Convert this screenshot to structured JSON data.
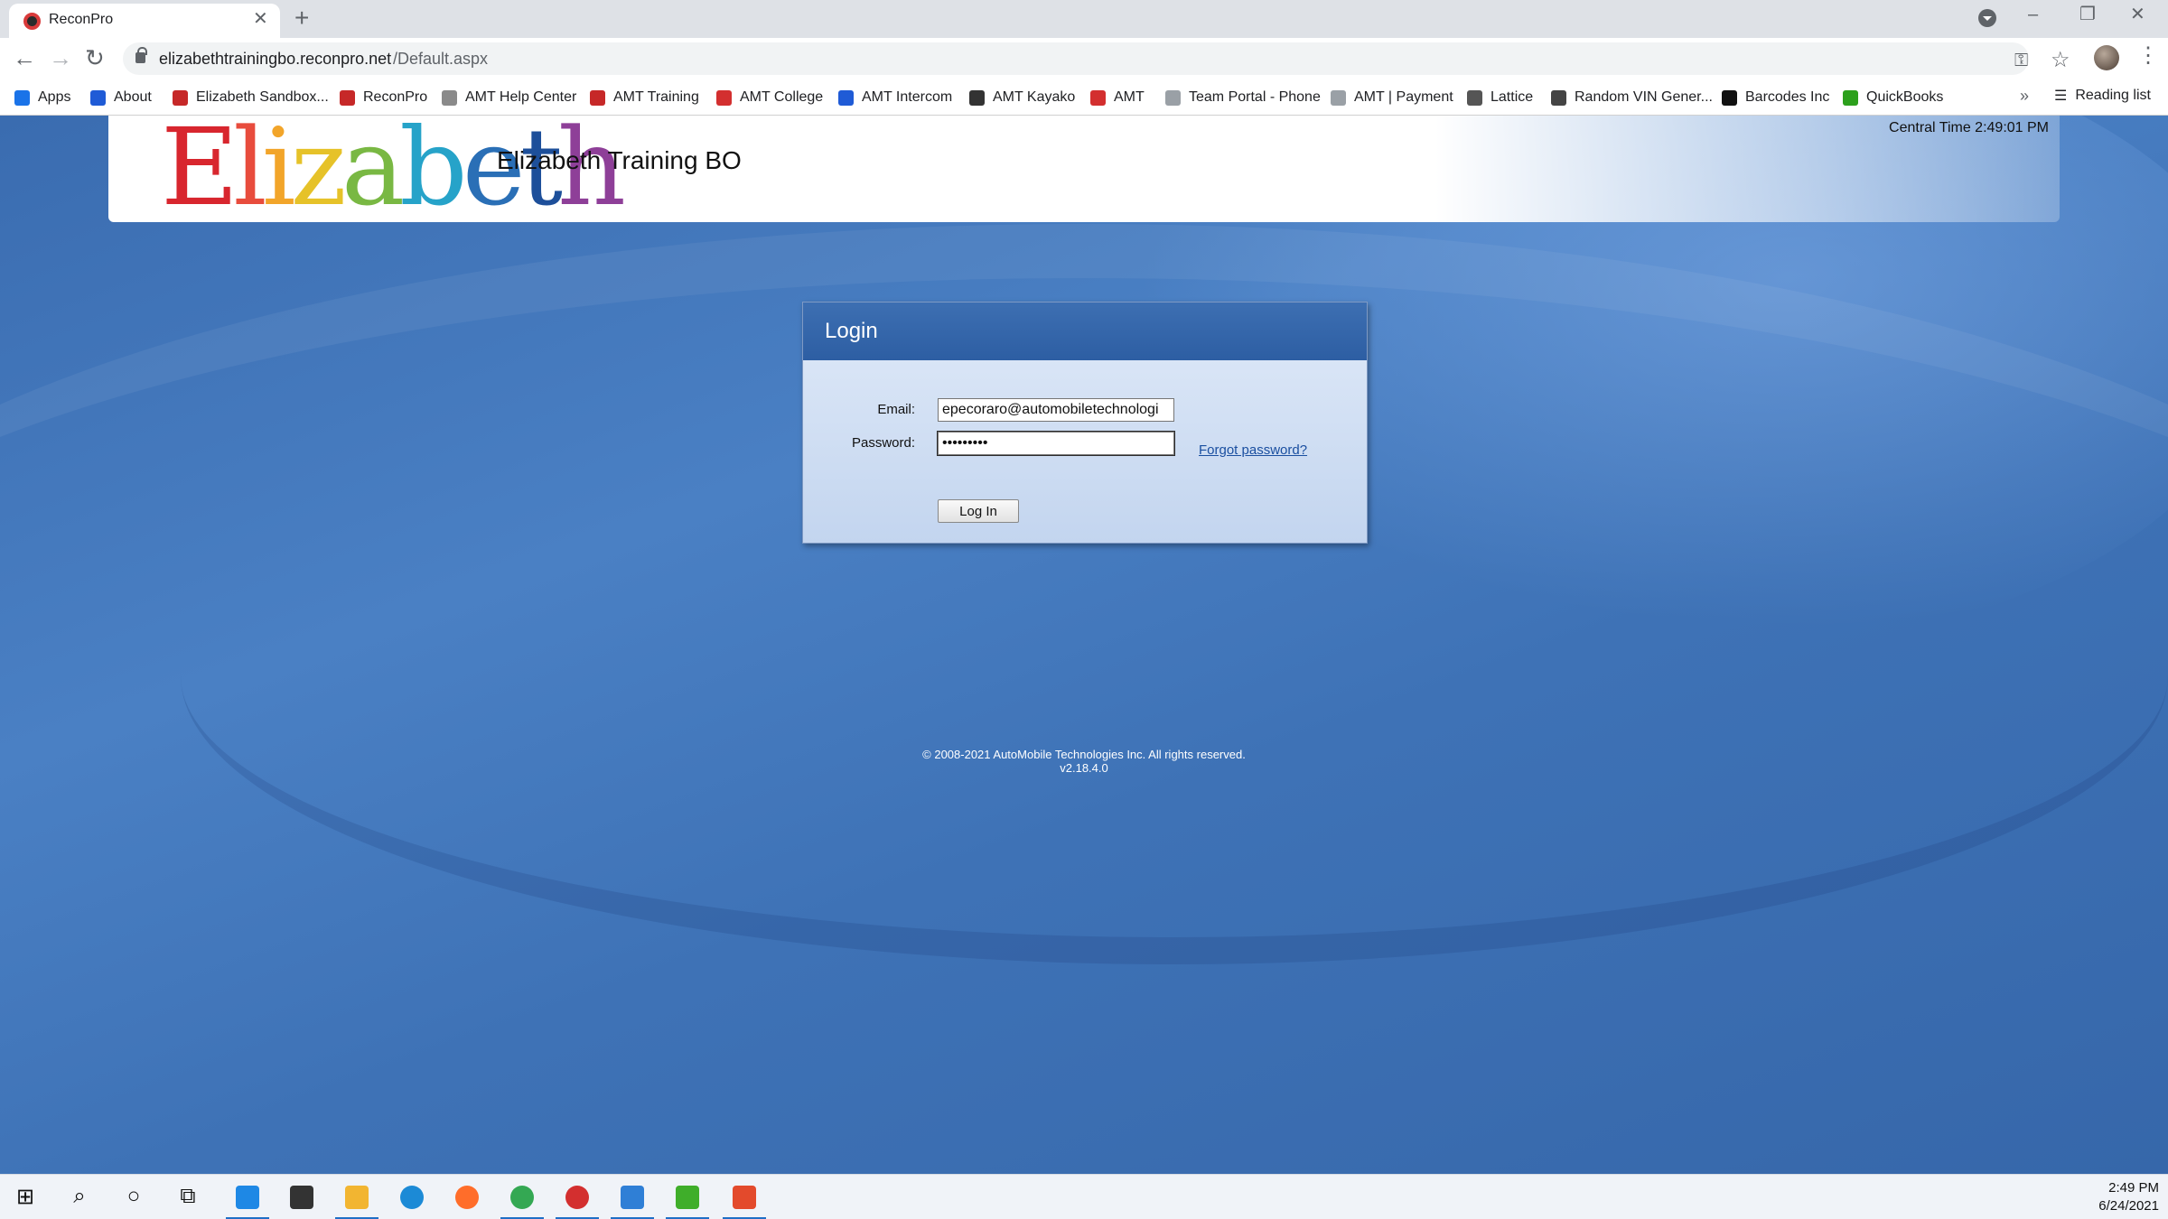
{
  "browser": {
    "tab_title": "ReconPro",
    "url_host": "elizabethtrainingbo.reconpro.net",
    "url_path": "/Default.aspx",
    "bookmarks": [
      {
        "label": "Apps",
        "icon": "apps-grid-icon",
        "color": "#1a73e8"
      },
      {
        "label": "About",
        "icon": "intercom-icon",
        "color": "#1f5bd6"
      },
      {
        "label": "Elizabeth Sandbox...",
        "icon": "reconpro-icon",
        "color": "#c62828"
      },
      {
        "label": "ReconPro",
        "icon": "reconpro-icon",
        "color": "#c62828"
      },
      {
        "label": "AMT Help Center",
        "icon": "book-icon",
        "color": "#8a8a8a"
      },
      {
        "label": "AMT Training",
        "icon": "reconpro-icon",
        "color": "#c62828"
      },
      {
        "label": "AMT College",
        "icon": "amt-logo-icon",
        "color": "#d32f2f"
      },
      {
        "label": "AMT Intercom",
        "icon": "intercom-icon",
        "color": "#1f5bd6"
      },
      {
        "label": "AMT Kayako",
        "icon": "kayako-icon",
        "color": "#333333"
      },
      {
        "label": "AMT",
        "icon": "amt-logo-icon",
        "color": "#d32f2f"
      },
      {
        "label": "Team Portal - Phone",
        "icon": "page-icon",
        "color": "#9aa0a6"
      },
      {
        "label": "AMT | Payment",
        "icon": "page-icon",
        "color": "#9aa0a6"
      },
      {
        "label": "Lattice",
        "icon": "lattice-icon",
        "color": "#555555"
      },
      {
        "label": "Random VIN Gener...",
        "icon": "globe-icon",
        "color": "#444444"
      },
      {
        "label": "Barcodes Inc",
        "icon": "barcodes-icon",
        "color": "#111111"
      },
      {
        "label": "QuickBooks",
        "icon": "quickbooks-icon",
        "color": "#2ca01c"
      }
    ],
    "reading_list": "Reading list"
  },
  "site": {
    "logo_text": "Elizabeth",
    "title": "Elizabeth Training BO",
    "clock": "Central Time 2:49:01 PM"
  },
  "login": {
    "heading": "Login",
    "email_label": "Email:",
    "email_value": "epecoraro@automobiletechnologi",
    "password_label": "Password:",
    "password_value": "•••••••••",
    "forgot_label": "Forgot password?",
    "submit_label": "Log In"
  },
  "footer": {
    "copyright": "© 2008-2021 AutoMobile Technologies Inc. All rights reserved.",
    "version": "v2.18.4.0"
  },
  "taskbar": {
    "apps": [
      {
        "name": "reconpro-app-icon",
        "color": "#1e88e5"
      },
      {
        "name": "store-icon",
        "color": "#333333"
      },
      {
        "name": "file-explorer-icon",
        "color": "#f2b531"
      },
      {
        "name": "edge-icon",
        "color": "#1c8ad6"
      },
      {
        "name": "firefox-icon",
        "color": "#ff6d2a"
      },
      {
        "name": "chrome-icon",
        "color": "#34a853"
      },
      {
        "name": "vivaldi-icon",
        "color": "#d32f2f"
      },
      {
        "name": "snagit-icon",
        "color": "#2f7fd6"
      },
      {
        "name": "camtasia-icon",
        "color": "#3fae2a"
      },
      {
        "name": "camtasia-recorder-icon",
        "color": "#e34a2c"
      }
    ],
    "time": "2:49 PM",
    "date": "6/24/2021"
  }
}
